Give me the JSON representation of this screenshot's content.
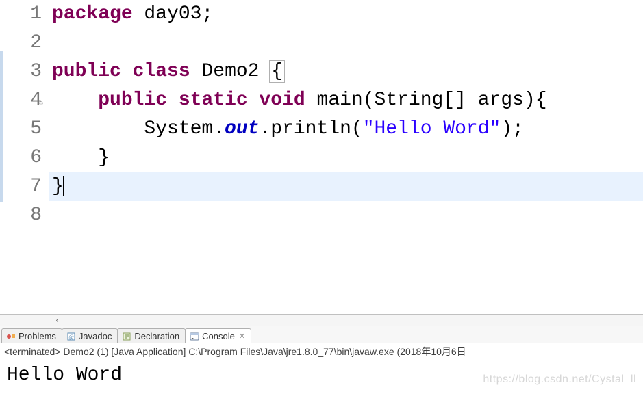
{
  "editor": {
    "lines": [
      {
        "n": 1,
        "tokens": [
          [
            "kw",
            "package"
          ],
          [
            "plain",
            " day03;"
          ]
        ]
      },
      {
        "n": 2,
        "tokens": []
      },
      {
        "n": 3,
        "tokens": [
          [
            "kw",
            "public"
          ],
          [
            "plain",
            " "
          ],
          [
            "kw",
            "class"
          ],
          [
            "plain",
            " Demo2 "
          ],
          [
            "box",
            "{"
          ]
        ]
      },
      {
        "n": 4,
        "ann": "⊖",
        "tokens": [
          [
            "plain",
            "    "
          ],
          [
            "kw",
            "public"
          ],
          [
            "plain",
            " "
          ],
          [
            "kw",
            "static"
          ],
          [
            "plain",
            " "
          ],
          [
            "kw",
            "void"
          ],
          [
            "plain",
            " main(String[] args){"
          ]
        ]
      },
      {
        "n": 5,
        "tokens": [
          [
            "plain",
            "        System."
          ],
          [
            "field-static",
            "out"
          ],
          [
            "plain",
            ".println("
          ],
          [
            "str",
            "\"Hello Word\""
          ],
          [
            "plain",
            ");"
          ]
        ]
      },
      {
        "n": 6,
        "tokens": [
          [
            "plain",
            "    }"
          ]
        ]
      },
      {
        "n": 7,
        "current": true,
        "tokens": [
          [
            "plain",
            "}"
          ],
          [
            "caret",
            ""
          ]
        ]
      },
      {
        "n": 8,
        "tokens": []
      }
    ]
  },
  "tabs": {
    "items": [
      {
        "id": "problems",
        "label": "Problems",
        "icon": "problems-icon"
      },
      {
        "id": "javadoc",
        "label": "Javadoc",
        "icon": "javadoc-icon"
      },
      {
        "id": "declaration",
        "label": "Declaration",
        "icon": "declaration-icon"
      },
      {
        "id": "console",
        "label": "Console",
        "icon": "console-icon",
        "active": true,
        "closable": true
      }
    ]
  },
  "console": {
    "header": "<terminated> Demo2 (1) [Java Application] C:\\Program Files\\Java\\jre1.8.0_77\\bin\\javaw.exe (2018年10月6日",
    "output": "Hello Word"
  },
  "watermark": "https://blog.csdn.net/Cystal_ll",
  "hscroll_arrow": "‹"
}
